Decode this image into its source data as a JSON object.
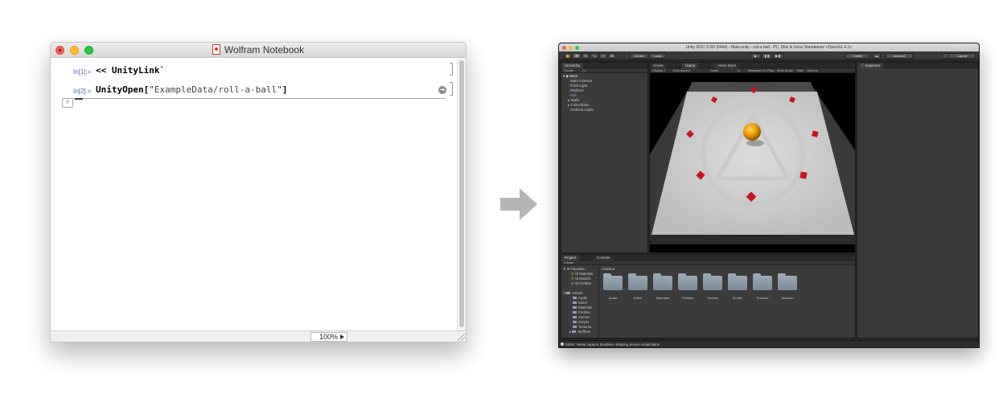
{
  "wolfram": {
    "window_title": "Wolfram Notebook",
    "cells": [
      {
        "label": "In[1]:=",
        "op": "<< ",
        "code": "UnityLink`"
      },
      {
        "label": "In[2]:=",
        "func": "UnityOpen",
        "open": "[",
        "arg": "\"ExampleData/roll-a-ball\"",
        "close": "]"
      }
    ],
    "add_cell_symbol": "+",
    "zoom": "100%"
  },
  "unity": {
    "window_title": "Unity 2017.3.0f3 (64bit) - Main.unity - roll-a-ball - PC, Mac & Linux Standalone <OpenGL 4.1>",
    "toolbar": {
      "pivot": "Center",
      "space": "Local",
      "collab": "Collab",
      "account": "Account",
      "layers": "Layers",
      "layout": "Layout"
    },
    "hierarchy": {
      "tab": "Hierarchy",
      "create": "Create",
      "search_placeholder": "All",
      "scene": "Main",
      "items": [
        "Main Camera",
        "Point Light",
        "Platform",
        "Ball",
        "Walls",
        "Collectibles",
        "Ambient Audio"
      ],
      "selected_index": 3
    },
    "scene_tabs": [
      "Scene",
      "Game",
      "Asset Store"
    ],
    "game_bar": {
      "display": "Display 1",
      "aspect": "Free Aspect",
      "scale_label": "Scale",
      "scale_value": "1x",
      "maximize": "Maximize On Play",
      "mute": "Mute Audio",
      "stats": "Stats",
      "gizmos": "Gizmos"
    },
    "inspector": {
      "tab": "Inspector"
    },
    "project": {
      "tabs": [
        "Project",
        "Console"
      ],
      "create": "Create",
      "favorites_label": "Favorites",
      "favorites": [
        "All Materials",
        "All Models",
        "All Prefabs"
      ],
      "assets_label": "Assets",
      "tree_folders": [
        "Audio",
        "Editor",
        "Materials",
        "Prefabs",
        "Scenes",
        "Scripts",
        "Textures",
        "Wolfram"
      ],
      "breadcrumb": "Assets",
      "folders": [
        "Audio",
        "Editor",
        "Materials",
        "Prefabs",
        "Scenes",
        "Scripts",
        "Textures",
        "Wolfram"
      ]
    },
    "status": "Editor: Metal support disabled, skipping device initialization"
  },
  "colors": {
    "arrow": "#b5b5b5",
    "ball": "#f0a000",
    "pickup": "#c8141e",
    "editor_bg": "#282828"
  }
}
